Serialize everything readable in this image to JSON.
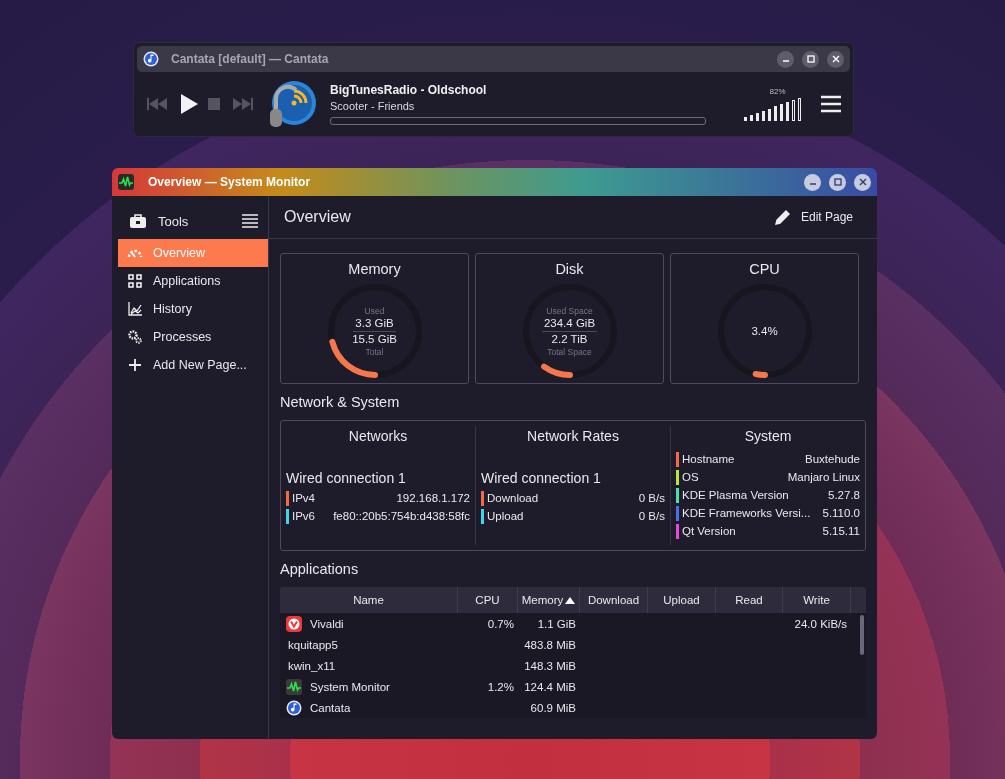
{
  "player": {
    "window": {
      "title": "Cantata [default] — Cantata"
    },
    "station": "BigTunesRadio -  Oldschool",
    "track": "Scooter - Friends",
    "progress": {
      "level": 0
    },
    "volume": {
      "reading": "82%",
      "level": 0.82
    }
  },
  "monitor": {
    "window": {
      "title": "Overview — System Monitor"
    },
    "sidebar": {
      "title": "Tools",
      "items": [
        {
          "label": "Overview",
          "kind": "gauge",
          "selected": true
        },
        {
          "label": "Applications",
          "kind": "grid",
          "selected": false
        },
        {
          "label": "History",
          "kind": "chart",
          "selected": false
        },
        {
          "label": "Processes",
          "kind": "gears",
          "selected": false
        },
        {
          "label": "Add New Page...",
          "kind": "add",
          "selected": false
        }
      ]
    },
    "page_title": "Overview",
    "edit_button": "Edit Page",
    "gauges": [
      {
        "title": "Memory",
        "top_label": "Used",
        "value": "3.3 GiB",
        "total": "15.5 GiB",
        "bottom_label": "Total",
        "level": 0.21
      },
      {
        "title": "Disk",
        "top_label": "Used Space",
        "value": "234.4 GiB",
        "total": "2.2 TiB",
        "bottom_label": "Total Space",
        "level": 0.1
      },
      {
        "title": "CPU",
        "value": "3.4%",
        "level": 0.034
      }
    ],
    "network_section": "Network & System",
    "panels": [
      {
        "title": "Networks",
        "subtitle": "Wired connection 1",
        "rows": [
          {
            "label": "IPv4",
            "value": "192.168.1.172",
            "color": "#f46a45"
          },
          {
            "label": "IPv6",
            "value": "fe80::20b5:754b:d438:58fc",
            "color": "#3fd6ea"
          }
        ]
      },
      {
        "title": "Network Rates",
        "subtitle": "Wired connection 1",
        "rows": [
          {
            "label": "Download",
            "value": "0 B/s",
            "color": "#f46a45"
          },
          {
            "label": "Upload",
            "value": "0 B/s",
            "color": "#3fd6ea"
          }
        ]
      },
      {
        "title": "System",
        "rows": [
          {
            "label": "Hostname",
            "value": "Buxtehude",
            "color": "#f46a45"
          },
          {
            "label": "OS",
            "value": "Manjaro Linux",
            "color": "#b8e83c"
          },
          {
            "label": "KDE Plasma Version",
            "value": "5.27.8",
            "color": "#3fe6b4"
          },
          {
            "label": "KDE Frameworks Versi...",
            "value": "5.110.0",
            "color": "#4a6ef0"
          },
          {
            "label": "Qt Version",
            "value": "5.15.11",
            "color": "#e64ae0"
          }
        ]
      }
    ],
    "applications_section": "Applications",
    "table": {
      "columns": [
        {
          "label": "Name",
          "sorted": false
        },
        {
          "label": "CPU",
          "sorted": false
        },
        {
          "label": "Memory",
          "sorted": true
        },
        {
          "label": "Download",
          "sorted": false
        },
        {
          "label": "Upload",
          "sorted": false
        },
        {
          "label": "Read",
          "sorted": false
        },
        {
          "label": "Write",
          "sorted": false
        }
      ],
      "rows": [
        {
          "kind": "browser",
          "cells": [
            "Vivaldi",
            "0.7%",
            "1.1 GiB",
            "",
            "",
            "",
            "24.0 KiB/s"
          ]
        },
        {
          "kind": "plain",
          "cells": [
            "kquitapp5",
            "",
            "483.8 MiB",
            "",
            "",
            "",
            ""
          ]
        },
        {
          "kind": "plain",
          "cells": [
            "kwin_x11",
            "",
            "148.3 MiB",
            "",
            "",
            "",
            ""
          ]
        },
        {
          "kind": "monitor",
          "cells": [
            "System Monitor",
            "1.2%",
            "124.4 MiB",
            "",
            "",
            "",
            ""
          ]
        },
        {
          "kind": "player",
          "cells": [
            "Cantata",
            "",
            "60.9 MiB",
            "",
            "",
            "",
            ""
          ]
        }
      ]
    }
  }
}
